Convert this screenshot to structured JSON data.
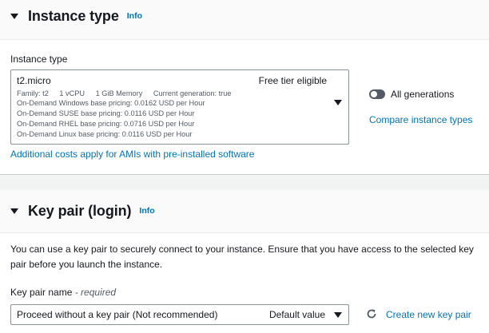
{
  "instance_type_section": {
    "title": "Instance type",
    "info": "Info",
    "field_label": "Instance type",
    "selected": {
      "name": "t2.micro",
      "badge": "Free tier eligible",
      "family": "Family: t2",
      "vcpu": "1 vCPU",
      "memory": "1 GiB Memory",
      "generation": "Current generation: true",
      "pricing": [
        "On-Demand Windows base pricing: 0.0162 USD per Hour",
        "On-Demand SUSE base pricing: 0.0116 USD per Hour",
        "On-Demand RHEL base pricing: 0.0716 USD per Hour",
        "On-Demand Linux base pricing: 0.0116 USD per Hour"
      ]
    },
    "toggle_label": "All generations",
    "compare_link": "Compare instance types",
    "additional_costs_link": "Additional costs apply for AMIs with pre-installed software"
  },
  "key_pair_section": {
    "title": "Key pair (login)",
    "info": "Info",
    "description": "You can use a key pair to securely connect to your instance. Ensure that you have access to the selected key pair before you launch the instance.",
    "field_label": "Key pair name",
    "field_required": "- required",
    "selected_value": "Proceed without a key pair (Not recommended)",
    "selected_tag": "Default value",
    "create_link": "Create new key pair"
  },
  "colors": {
    "link": "#0073bb",
    "text": "#16191f",
    "secondary_text": "#545b64",
    "border": "#879596"
  }
}
